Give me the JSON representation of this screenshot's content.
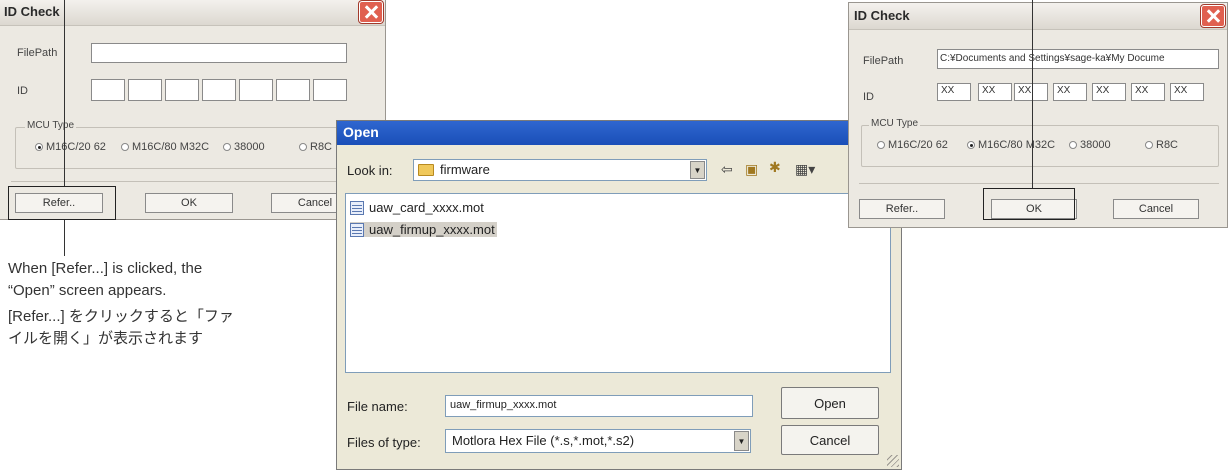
{
  "left_dialog": {
    "title": "ID Check",
    "filepath_label": "FilePath",
    "filepath_value": "",
    "id_label": "ID",
    "id_values": [
      "",
      "",
      "",
      "",
      "",
      "",
      ""
    ],
    "mcu_group_label": "MCU Type",
    "mcu_options": [
      "M16C/20 62",
      "M16C/80  M32C",
      "38000",
      "R8C"
    ],
    "mcu_selected_index": 0,
    "refer_label": "Refer..",
    "ok_label": "OK",
    "cancel_label": "Cancel"
  },
  "right_dialog": {
    "title": "ID Check",
    "filepath_label": "FilePath",
    "filepath_value": "C:¥Documents and Settings¥sage-ka¥My Docume",
    "id_label": "ID",
    "id_values": [
      "XX",
      "XX",
      "XX",
      "XX",
      "XX",
      "XX",
      "XX"
    ],
    "mcu_group_label": "MCU Type",
    "mcu_options": [
      "M16C/20 62",
      "M16C/80  M32C",
      "38000",
      "R8C"
    ],
    "mcu_selected_index": 1,
    "refer_label": "Refer..",
    "ok_label": "OK",
    "cancel_label": "Cancel"
  },
  "open_dialog": {
    "title": "Open",
    "look_in_label": "Look in:",
    "look_in_value": "firmware",
    "files": [
      "uaw_card_xxxx.mot",
      "uaw_firmup_xxxx.mot"
    ],
    "selected_file_index": 1,
    "file_name_label": "File name:",
    "file_name_value": "uaw_firmup_xxxx.mot",
    "files_of_type_label": "Files of type:",
    "files_of_type_value": "Motlora Hex File (*.s,*.mot,*.s2)",
    "open_label": "Open",
    "cancel_label": "Cancel"
  },
  "annotation": {
    "english_line1": "When [Refer...] is clicked, the",
    "english_line2": "“Open” screen appears.",
    "japanese_line1": "[Refer...] をクリックすると「ファ",
    "japanese_line2": "イルを開く」が表示されます"
  },
  "colors": {
    "dialog_bg": "#ece9e2",
    "close_button": "#e06050",
    "open_titlebar": "#1a4fb8",
    "selection": "#d4d0c8"
  }
}
